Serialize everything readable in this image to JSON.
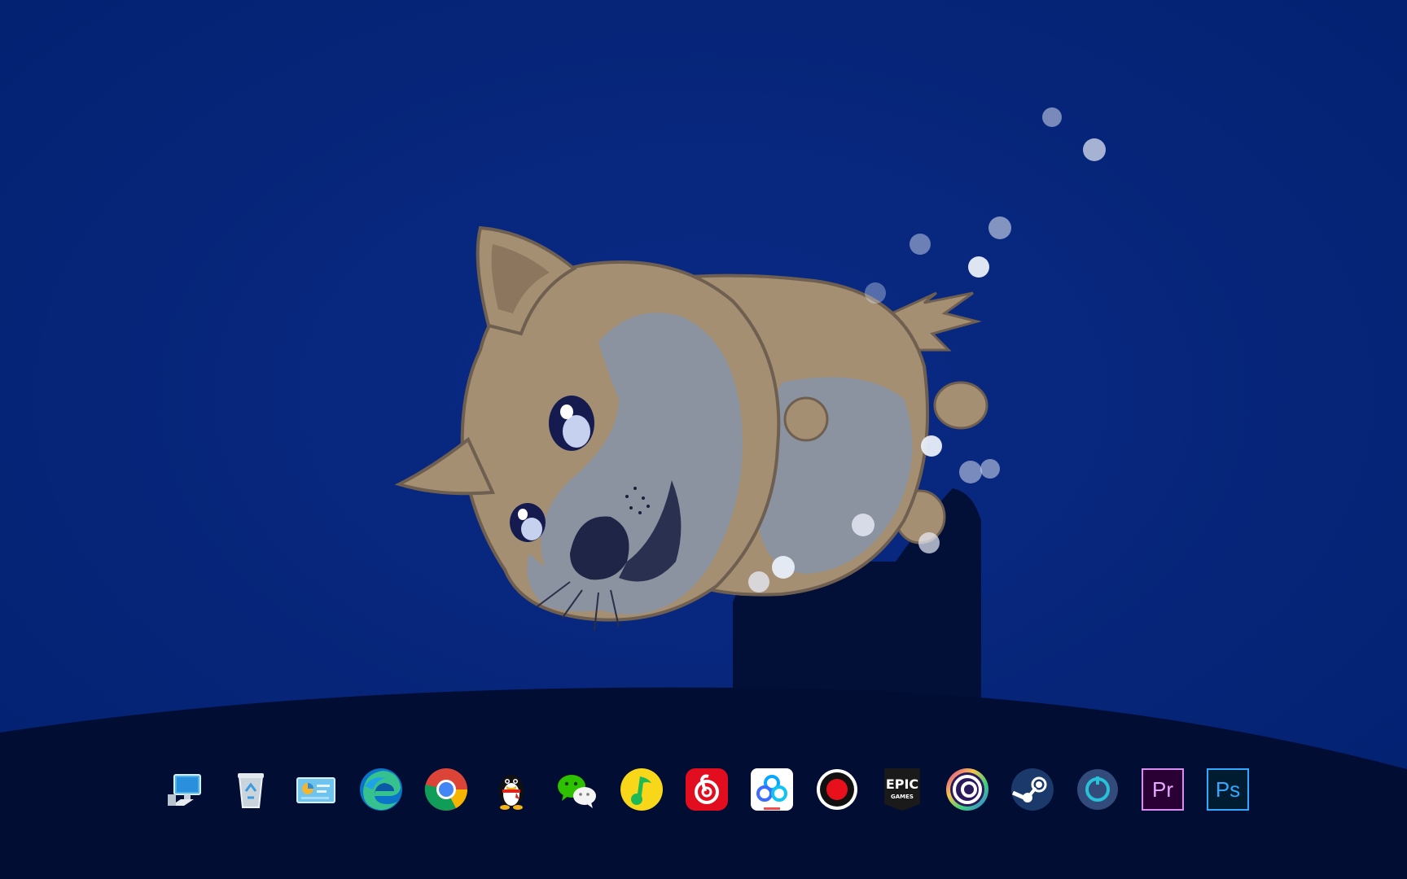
{
  "desktop": {
    "wallpaper": {
      "subject": "shiba-inu-dog-illustration",
      "colors": {
        "sky": "#042277",
        "ground": "#010d33",
        "pedestal": "#020f37",
        "bubble": "#e9eef9"
      }
    }
  },
  "dock": {
    "items": [
      {
        "name": "this-pc",
        "icon": "computer-icon"
      },
      {
        "name": "recycle-bin",
        "icon": "recycle-bin-icon"
      },
      {
        "name": "control-panel",
        "icon": "control-panel-icon"
      },
      {
        "name": "microsoft-edge",
        "icon": "edge-icon"
      },
      {
        "name": "google-chrome",
        "icon": "chrome-icon"
      },
      {
        "name": "qq",
        "icon": "qq-penguin-icon"
      },
      {
        "name": "wechat",
        "icon": "wechat-icon"
      },
      {
        "name": "qq-music",
        "icon": "qq-music-icon"
      },
      {
        "name": "netease-cloud-music",
        "icon": "netease-music-icon"
      },
      {
        "name": "baidu-netdisk",
        "icon": "baidu-netdisk-icon"
      },
      {
        "name": "screen-recorder",
        "icon": "record-icon"
      },
      {
        "name": "epic-games-launcher",
        "icon": "epic-games-icon",
        "label_line1": "EPIC",
        "label_line2": "GAMES"
      },
      {
        "name": "ubisoft-connect",
        "icon": "ubisoft-icon"
      },
      {
        "name": "steam",
        "icon": "steam-icon"
      },
      {
        "name": "app-circle",
        "icon": "circle-app-icon"
      },
      {
        "name": "adobe-premiere-pro",
        "icon": "premiere-pro-icon",
        "label": "Pr"
      },
      {
        "name": "adobe-photoshop",
        "icon": "photoshop-icon",
        "label": "Ps"
      }
    ]
  }
}
